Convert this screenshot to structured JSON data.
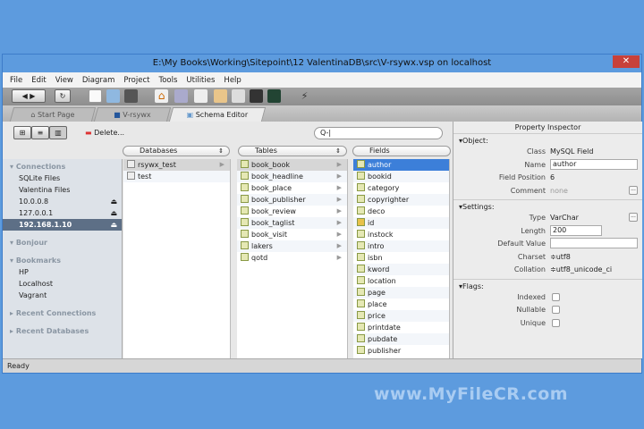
{
  "window": {
    "title": "E:\\My Books\\Working\\Sitepoint\\12 ValentinaDB\\src\\V-rsywx.vsp on localhost",
    "close": "✕"
  },
  "menu": [
    "File",
    "Edit",
    "View",
    "Diagram",
    "Project",
    "Tools",
    "Utilities",
    "Help"
  ],
  "tabs": [
    {
      "label": "Start Page"
    },
    {
      "label": "V-rsywx"
    },
    {
      "label": "Schema Editor"
    }
  ],
  "content_toolbar": {
    "delete_label": "Delete...",
    "search_value": "Q-|"
  },
  "columns": {
    "databases": "Databases",
    "tables": "Tables",
    "fields": "Fields"
  },
  "sidebar": {
    "connections_header": "Connections",
    "connections": [
      "SQLite Files",
      "Valentina Files",
      "10.0.0.8",
      "127.0.0.1",
      "192.168.1.10"
    ],
    "bonjour_header": "Bonjour",
    "bookmarks_header": "Bookmarks",
    "bookmarks": [
      "HP",
      "Localhost",
      "Vagrant"
    ],
    "recent_connections": "Recent Connections",
    "recent_databases": "Recent Databases"
  },
  "databases": [
    "rsywx_test",
    "test"
  ],
  "tables": [
    "book_book",
    "book_headline",
    "book_place",
    "book_publisher",
    "book_review",
    "book_taglist",
    "book_visit",
    "lakers",
    "qotd"
  ],
  "fields": [
    "author",
    "bookid",
    "category",
    "copyrighter",
    "deco",
    "id",
    "instock",
    "intro",
    "isbn",
    "kword",
    "location",
    "page",
    "place",
    "price",
    "printdate",
    "pubdate",
    "publisher"
  ],
  "inspector": {
    "title": "Property Inspector",
    "object_header": "Object:",
    "class_label": "Class",
    "class_value": "MySQL Field",
    "name_label": "Name",
    "name_value": "author",
    "position_label": "Field Position",
    "position_value": "6",
    "comment_label": "Comment",
    "comment_value": "none",
    "settings_header": "Settings:",
    "type_label": "Type",
    "type_value": "VarChar",
    "length_label": "Length",
    "length_value": "200",
    "default_label": "Default Value",
    "default_value": "",
    "charset_label": "Charset",
    "charset_value": "≑utf8",
    "collation_label": "Collation",
    "collation_value": "≑utf8_unicode_ci",
    "flags_header": "Flags:",
    "indexed_label": "Indexed",
    "nullable_label": "Nullable",
    "unique_label": "Unique"
  },
  "status": "Ready",
  "watermark": "www.MyFileCR.com"
}
